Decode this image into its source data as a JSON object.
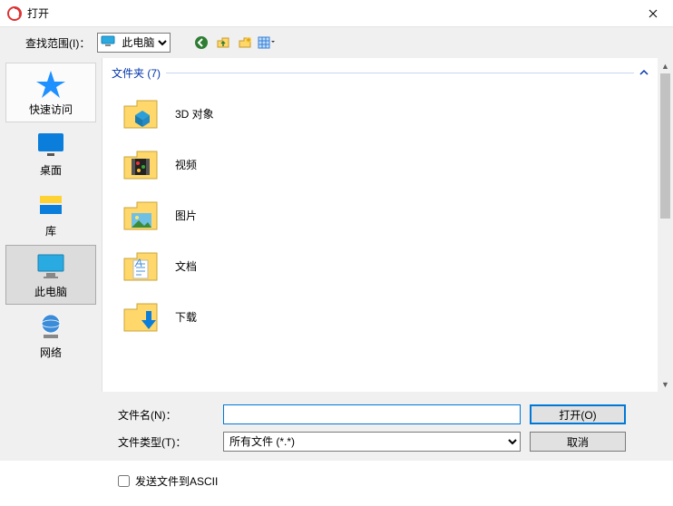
{
  "titlebar": {
    "title": "打开"
  },
  "toprow": {
    "label": "查找范围(I)：",
    "location": "此电脑"
  },
  "sidebar": {
    "items": [
      {
        "label": "快速访问"
      },
      {
        "label": "桌面"
      },
      {
        "label": "库"
      },
      {
        "label": "此电脑"
      },
      {
        "label": "网络"
      }
    ]
  },
  "filelist": {
    "group_header": "文件夹 (7)",
    "items": [
      {
        "label": "3D 对象"
      },
      {
        "label": "视频"
      },
      {
        "label": "图片"
      },
      {
        "label": "文档"
      },
      {
        "label": "下载"
      }
    ]
  },
  "bottom": {
    "filename_label": "文件名(N)：",
    "filename_value": "",
    "filetype_label": "文件类型(T)：",
    "filetype_value": "所有文件 (*.*)",
    "open_btn": "打开(O)",
    "cancel_btn": "取消",
    "checkbox_label": "发送文件到ASCII"
  }
}
